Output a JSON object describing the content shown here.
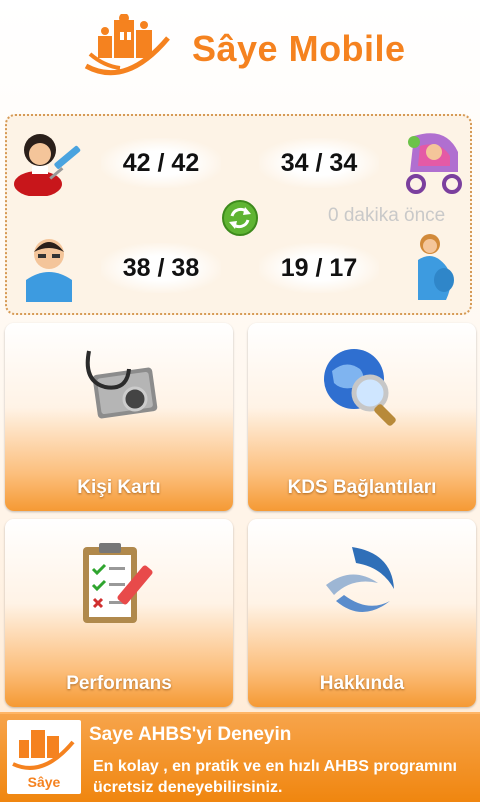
{
  "header": {
    "app_title": "Sâye Mobile",
    "logo_icon": "family-logo-icon",
    "brand_color": "#f5821f"
  },
  "stats": {
    "vaccination": {
      "value": "42 / 42",
      "icon": "nurse-vaccine-icon"
    },
    "infant": {
      "value": "34 / 34",
      "icon": "baby-stroller-icon"
    },
    "child": {
      "value": "38 / 38",
      "icon": "child-icon"
    },
    "pregnant": {
      "value": "19 / 17",
      "icon": "pregnant-woman-icon"
    },
    "refresh_icon": "refresh-icon",
    "updated_text": "0 dakika önce"
  },
  "tiles": [
    {
      "label": "Kişi Kartı",
      "icon": "stethoscope-icon"
    },
    {
      "label": "KDS Bağlantıları",
      "icon": "globe-search-icon"
    },
    {
      "label": "Performans",
      "icon": "clipboard-checklist-icon"
    },
    {
      "label": "Hakkında",
      "icon": "swirl-arrows-icon"
    }
  ],
  "banner": {
    "title": "Saye AHBS'yi Deneyin",
    "description": "En kolay , en pratik ve en hızlı AHBS programını ücretsiz deneyebilirsiniz.",
    "logo_text": "Sâye"
  }
}
